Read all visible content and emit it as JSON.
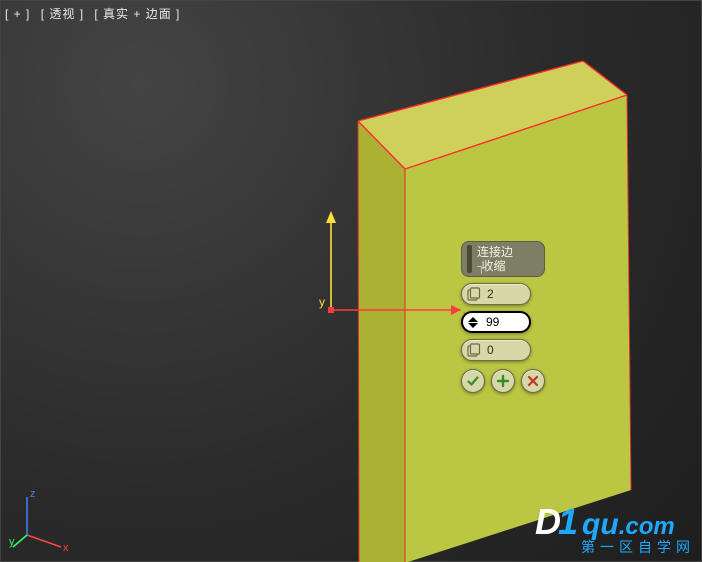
{
  "viewport": {
    "labels": [
      "[ + ]",
      "[ 透视 ]",
      "[ 真实 + 边面 ]"
    ]
  },
  "gizmo": {
    "axis_x": "x",
    "axis_y": "y"
  },
  "tripod": {
    "x": "x",
    "y": "y",
    "z": "z"
  },
  "panel": {
    "title": "连接边",
    "subtitle": "收缩",
    "spinners": [
      {
        "name": "segments",
        "value": "2",
        "icon": "page-stack-icon",
        "active": false
      },
      {
        "name": "pinch",
        "value": "99",
        "icon": "spinner-arrows-icon",
        "active": true
      },
      {
        "name": "slide",
        "value": "0",
        "icon": "page-stack-icon",
        "active": false
      }
    ],
    "buttons": {
      "apply": "✓",
      "apply_new": "+",
      "cancel": "✕"
    }
  },
  "watermark": {
    "d": "D",
    "one": "1",
    "domain": "qu",
    "ext": ".com",
    "sub": "第一区自学网"
  }
}
